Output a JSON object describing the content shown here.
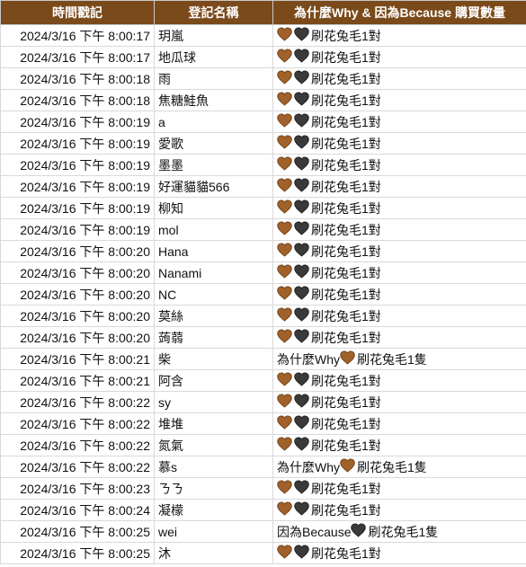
{
  "colors": {
    "header_bg": "#7b4a1a",
    "heart_brown": "#a0612a",
    "heart_dark": "#3a3a3a"
  },
  "headers": [
    "時間戳記",
    "登記名稱",
    "為什麼Why & 因為Because 購買數量"
  ],
  "rows": [
    {
      "time": "2024/3/16 下午 8:00:17",
      "name": "玥嵐",
      "pre": "",
      "hearts": [
        "heart-brown",
        "heart-dark"
      ],
      "item": "刷花兔毛1對"
    },
    {
      "time": "2024/3/16 下午 8:00:17",
      "name": "地瓜球",
      "pre": "",
      "hearts": [
        "heart-brown",
        "heart-dark"
      ],
      "item": "刷花兔毛1對"
    },
    {
      "time": "2024/3/16 下午 8:00:18",
      "name": "雨",
      "pre": "",
      "hearts": [
        "heart-brown",
        "heart-dark"
      ],
      "item": "刷花兔毛1對"
    },
    {
      "time": "2024/3/16 下午 8:00:18",
      "name": "焦糖鮭魚",
      "pre": "",
      "hearts": [
        "heart-brown",
        "heart-dark"
      ],
      "item": "刷花兔毛1對"
    },
    {
      "time": "2024/3/16 下午 8:00:19",
      "name": "a",
      "pre": "",
      "hearts": [
        "heart-brown",
        "heart-dark"
      ],
      "item": "刷花兔毛1對"
    },
    {
      "time": "2024/3/16 下午 8:00:19",
      "name": "愛歌",
      "pre": "",
      "hearts": [
        "heart-brown",
        "heart-dark"
      ],
      "item": "刷花兔毛1對"
    },
    {
      "time": "2024/3/16 下午 8:00:19",
      "name": "墨墨",
      "pre": "",
      "hearts": [
        "heart-brown",
        "heart-dark"
      ],
      "item": "刷花兔毛1對"
    },
    {
      "time": "2024/3/16 下午 8:00:19",
      "name": "好運貓貓566",
      "pre": "",
      "hearts": [
        "heart-brown",
        "heart-dark"
      ],
      "item": "刷花兔毛1對"
    },
    {
      "time": "2024/3/16 下午 8:00:19",
      "name": "柳知",
      "pre": "",
      "hearts": [
        "heart-brown",
        "heart-dark"
      ],
      "item": "刷花兔毛1對"
    },
    {
      "time": "2024/3/16 下午 8:00:19",
      "name": "mol",
      "pre": "",
      "hearts": [
        "heart-brown",
        "heart-dark"
      ],
      "item": "刷花兔毛1對"
    },
    {
      "time": "2024/3/16 下午 8:00:20",
      "name": "Hana",
      "pre": "",
      "hearts": [
        "heart-brown",
        "heart-dark"
      ],
      "item": "刷花兔毛1對"
    },
    {
      "time": "2024/3/16 下午 8:00:20",
      "name": "Nanami",
      "pre": "",
      "hearts": [
        "heart-brown",
        "heart-dark"
      ],
      "item": "刷花兔毛1對"
    },
    {
      "time": "2024/3/16 下午 8:00:20",
      "name": "NC",
      "pre": "",
      "hearts": [
        "heart-brown",
        "heart-dark"
      ],
      "item": "刷花兔毛1對"
    },
    {
      "time": "2024/3/16 下午 8:00:20",
      "name": "莫絲",
      "pre": "",
      "hearts": [
        "heart-brown",
        "heart-dark"
      ],
      "item": "刷花兔毛1對"
    },
    {
      "time": "2024/3/16 下午 8:00:20",
      "name": "蒟蒻",
      "pre": "",
      "hearts": [
        "heart-brown",
        "heart-dark"
      ],
      "item": "刷花兔毛1對"
    },
    {
      "time": "2024/3/16 下午 8:00:21",
      "name": "柴",
      "pre": "為什麼Why",
      "hearts": [
        "heart-brown"
      ],
      "item": "刷花兔毛1隻"
    },
    {
      "time": "2024/3/16 下午 8:00:21",
      "name": "阿含",
      "pre": "",
      "hearts": [
        "heart-brown",
        "heart-dark"
      ],
      "item": "刷花兔毛1對"
    },
    {
      "time": "2024/3/16 下午 8:00:22",
      "name": "sy",
      "pre": "",
      "hearts": [
        "heart-brown",
        "heart-dark"
      ],
      "item": "刷花兔毛1對"
    },
    {
      "time": "2024/3/16 下午 8:00:22",
      "name": "堆堆",
      "pre": "",
      "hearts": [
        "heart-brown",
        "heart-dark"
      ],
      "item": "刷花兔毛1對"
    },
    {
      "time": "2024/3/16 下午 8:00:22",
      "name": "氮氣",
      "pre": "",
      "hearts": [
        "heart-brown",
        "heart-dark"
      ],
      "item": "刷花兔毛1對"
    },
    {
      "time": "2024/3/16 下午 8:00:22",
      "name": "慕s",
      "pre": "為什麼Why",
      "hearts": [
        "heart-brown"
      ],
      "item": "刷花兔毛1隻"
    },
    {
      "time": "2024/3/16 下午 8:00:23",
      "name": "ㄋㄋ",
      "pre": "",
      "hearts": [
        "heart-brown",
        "heart-dark"
      ],
      "item": "刷花兔毛1對"
    },
    {
      "time": "2024/3/16 下午 8:00:24",
      "name": "凝檬",
      "pre": "",
      "hearts": [
        "heart-brown",
        "heart-dark"
      ],
      "item": "刷花兔毛1對"
    },
    {
      "time": "2024/3/16 下午 8:00:25",
      "name": "wei",
      "pre": "因為Because",
      "hearts": [
        "heart-dark"
      ],
      "item": "刷花兔毛1隻"
    },
    {
      "time": "2024/3/16 下午 8:00:25",
      "name": "沐",
      "pre": "",
      "hearts": [
        "heart-brown",
        "heart-dark"
      ],
      "item": "刷花兔毛1對"
    }
  ]
}
